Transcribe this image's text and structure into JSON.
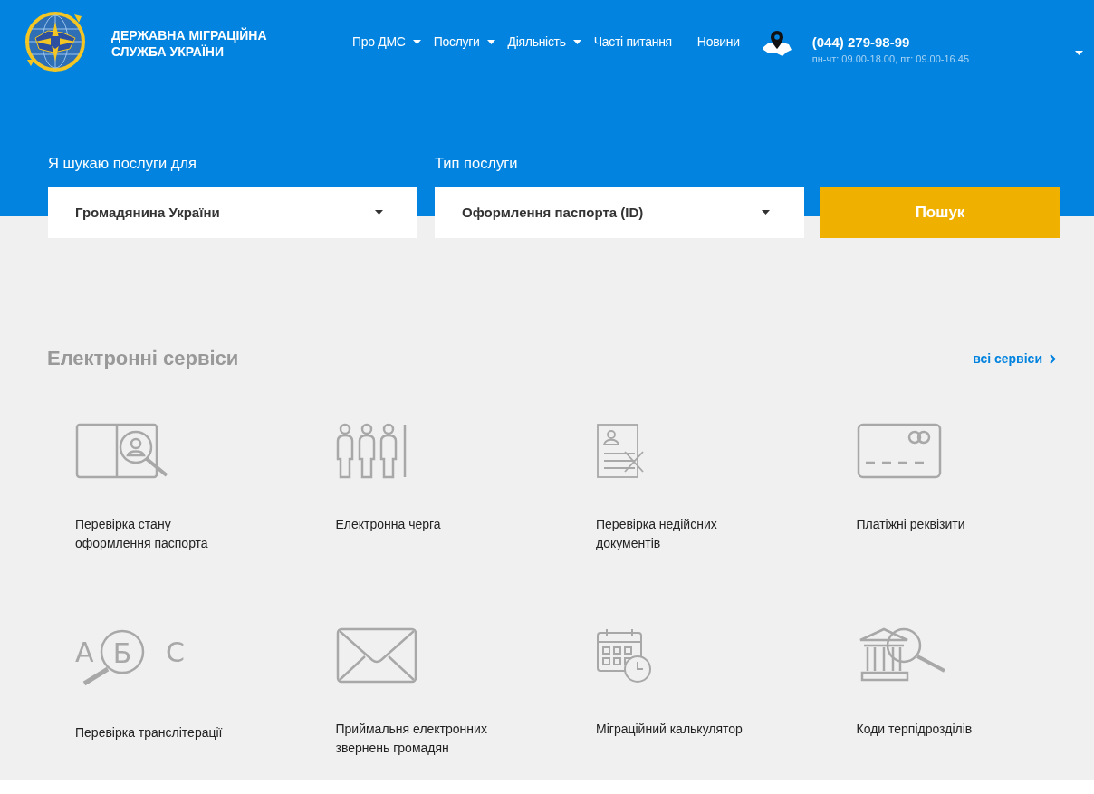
{
  "header": {
    "org_name_line1": "ДЕРЖАВНА МІГРАЦІЙНА",
    "org_name_line2": "СЛУЖБА УКРАЇНИ",
    "nav": [
      {
        "label": "Про ДМС",
        "dropdown": true
      },
      {
        "label": "Послуги",
        "dropdown": true
      },
      {
        "label": "Діяльність",
        "dropdown": true
      },
      {
        "label": "Часті питання",
        "dropdown": false
      },
      {
        "label": "Новини",
        "dropdown": false
      }
    ],
    "phone": "(044) 279-98-99",
    "hours": "пн-чт: 09.00-18.00, пт: 09.00-16.45"
  },
  "search": {
    "audience_label": "Я шукаю послуги для",
    "audience_value": "Громадянина України",
    "type_label": "Тип послуги",
    "type_value": "Оформлення паспорта (ID)",
    "button": "Пошук"
  },
  "services": {
    "title": "Електронні сервіси",
    "all_link": "всі сервіси",
    "items": [
      {
        "kind": "passport-search",
        "label": "Перевірка стану оформлення паспорта"
      },
      {
        "kind": "queue",
        "label": "Електронна черга"
      },
      {
        "kind": "invalid-docs",
        "label": "Перевірка недійсних документів"
      },
      {
        "kind": "card",
        "label": "Платіжні реквізити"
      },
      {
        "kind": "transliteration",
        "label": "Перевірка транслітерації",
        "letters": [
          "А",
          "Б",
          "С"
        ]
      },
      {
        "kind": "envelope",
        "label": "Приймальня електронних звернень громадян"
      },
      {
        "kind": "calendar",
        "label": "Міграційний калькулятор"
      },
      {
        "kind": "building-search",
        "label": "Коди терпідрозділів"
      }
    ]
  }
}
